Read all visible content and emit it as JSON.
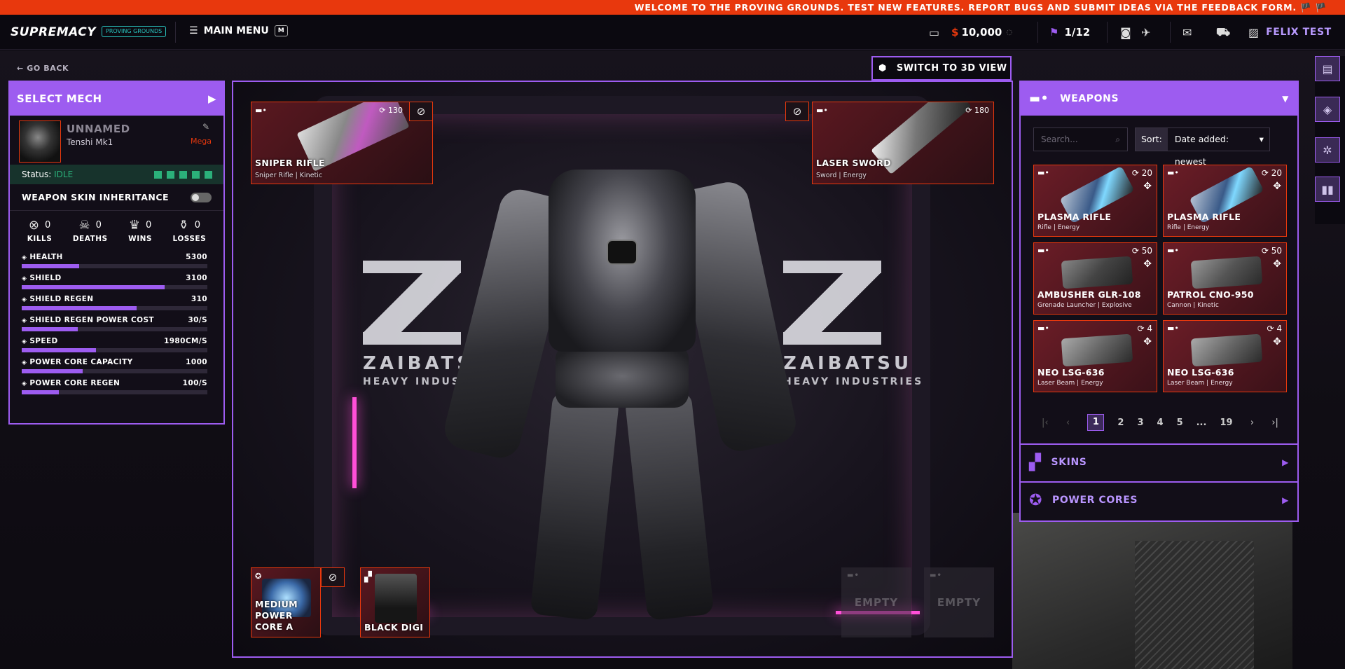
{
  "banner": "WELCOME TO THE PROVING GROUNDS. TEST NEW FEATURES. REPORT BUGS AND SUBMIT IDEAS VIA THE FEEDBACK FORM. 🏴 🏴",
  "header": {
    "logo": "SUPREMACY",
    "badge": "PROVING GROUNDS",
    "main_menu": "MAIN MENU",
    "main_menu_key": "M",
    "balance": "10,000",
    "balance_prefix": "$",
    "quests": "1/12",
    "username": "FELIX TEST"
  },
  "nav": {
    "go_back": "GO BACK",
    "switch_view": "SWITCH TO 3D VIEW"
  },
  "left_panel": {
    "title": "SELECT MECH",
    "mech_name": "UNNAMED",
    "mech_model": "Tenshi Mk1",
    "tier": "Mega",
    "status_label": "Status:",
    "status_value": "IDLE",
    "skin_inheritance": "WEAPON SKIN INHERITANCE",
    "record": [
      {
        "label": "KILLS",
        "value": "0"
      },
      {
        "label": "DEATHS",
        "value": "0"
      },
      {
        "label": "WINS",
        "value": "0"
      },
      {
        "label": "LOSSES",
        "value": "0"
      }
    ],
    "attributes": [
      {
        "label": "HEALTH",
        "value": "5300",
        "fill": 0.31
      },
      {
        "label": "SHIELD",
        "value": "3100",
        "fill": 0.77
      },
      {
        "label": "SHIELD REGEN",
        "value": "310",
        "fill": 0.62
      },
      {
        "label": "SHIELD REGEN POWER COST",
        "value": "30/S",
        "fill": 0.3
      },
      {
        "label": "SPEED",
        "value": "1980CM/S",
        "fill": 0.4
      },
      {
        "label": "POWER CORE CAPACITY",
        "value": "1000",
        "fill": 0.33
      },
      {
        "label": "POWER CORE REGEN",
        "value": "100/S",
        "fill": 0.2
      }
    ]
  },
  "loadout": {
    "weapon_left": {
      "name": "SNIPER RIFLE",
      "sub": "Sniper Rifle | Kinetic",
      "ammo": "130"
    },
    "weapon_right": {
      "name": "LASER SWORD",
      "sub": "Sword | Energy",
      "ammo": "180"
    },
    "power_core": {
      "name": "MEDIUM POWER CORE A"
    },
    "skin": {
      "name": "BLACK DIGI"
    },
    "empty_1": "EMPTY",
    "empty_2": "EMPTY"
  },
  "scene_text": {
    "brand": "ZAIBATSU",
    "brand_sub": "HEAVY INDUSTRIES"
  },
  "right_panel": {
    "title": "WEAPONS",
    "search_placeholder": "Search...",
    "sort_label": "Sort:",
    "sort_value": "Date added: newest",
    "items": [
      {
        "name": "PLASMA RIFLE",
        "sub": "Rifle | Energy",
        "ammo": "20"
      },
      {
        "name": "PLASMA RIFLE",
        "sub": "Rifle | Energy",
        "ammo": "20"
      },
      {
        "name": "AMBUSHER GLR-108",
        "sub": "Grenade Launcher | Explosive",
        "ammo": "50"
      },
      {
        "name": "PATROL CNO-950",
        "sub": "Cannon | Kinetic",
        "ammo": "50"
      },
      {
        "name": "NEO LSG-636",
        "sub": "Laser Beam | Energy",
        "ammo": "4"
      },
      {
        "name": "NEO LSG-636",
        "sub": "Laser Beam | Energy",
        "ammo": "4"
      }
    ],
    "pages": [
      "1",
      "2",
      "3",
      "4",
      "5",
      "...",
      "19"
    ],
    "current_page": "1",
    "skins_label": "SKINS",
    "power_cores_label": "POWER CORES"
  },
  "colors": {
    "accent": "#9d5cf0",
    "banner": "#e8380d",
    "status": "#2bb07a",
    "card": "#6b1d27"
  }
}
